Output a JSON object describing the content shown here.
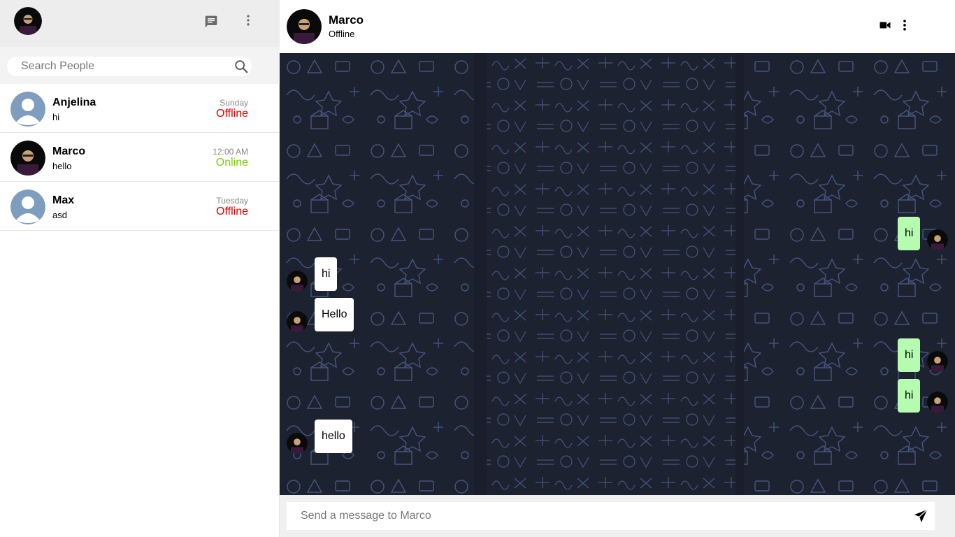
{
  "sidebar": {
    "search": {
      "placeholder": "Search People"
    },
    "contacts": [
      {
        "name": "Anjelina",
        "last_message": "hi",
        "time": "Sunday",
        "status": "Offline",
        "status_color": "#e00000",
        "avatar": "default-user-avatar"
      },
      {
        "name": "Marco",
        "last_message": "hello",
        "time": "12:00 AM",
        "status": "Online",
        "status_color": "#7ccf00",
        "avatar": "profile-photo-avatar"
      },
      {
        "name": "Max",
        "last_message": "asd",
        "time": "Tuesday",
        "status": "Offline",
        "status_color": "#e00000",
        "avatar": "default-user-avatar"
      }
    ],
    "header_icons": [
      "profile-avatar",
      "chat-icon",
      "more-vertical-icon"
    ]
  },
  "chat": {
    "contact_name": "Marco",
    "contact_status": "Offline",
    "header_icons": [
      "video-icon",
      "more-vertical-icon"
    ],
    "messages": [
      {
        "direction": "outgoing",
        "text": "hi"
      },
      {
        "direction": "incoming",
        "text": "hi"
      },
      {
        "direction": "incoming",
        "text": "Hello"
      },
      {
        "direction": "outgoing",
        "text": "hi"
      },
      {
        "direction": "outgoing",
        "text": "hi"
      },
      {
        "direction": "incoming",
        "text": "hello"
      }
    ],
    "composer": {
      "placeholder": "Send a message to Marco",
      "send_icon": "send-icon"
    }
  },
  "colors": {
    "sidebar_header_bg": "#ededed",
    "chat_wallpaper_bg": "#1d2230",
    "incoming_bubble": "#ffffff",
    "outgoing_bubble": "#b5fbb0",
    "online": "#7ccf00",
    "offline": "#e00000"
  }
}
